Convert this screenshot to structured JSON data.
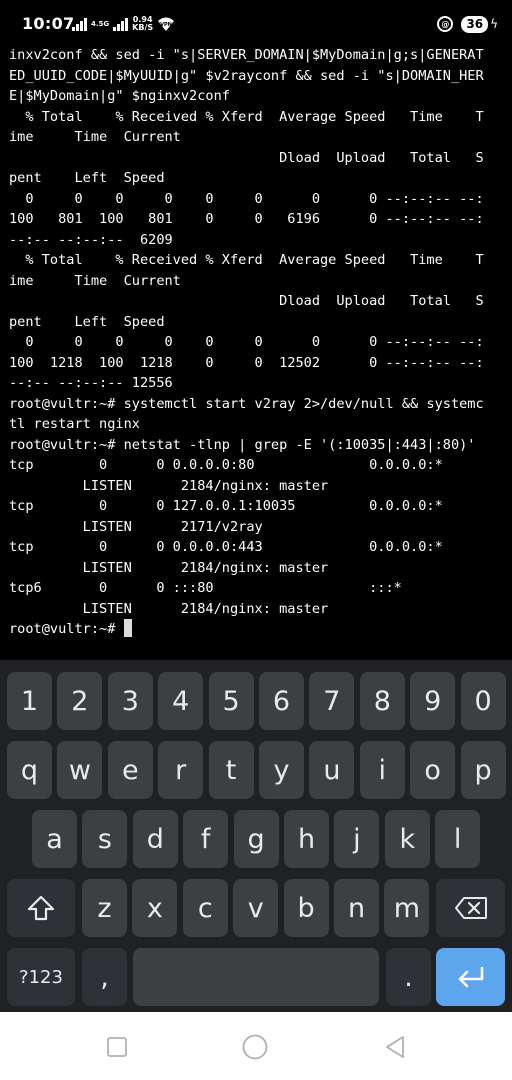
{
  "status": {
    "time": "10:07",
    "net_type": "4.5G",
    "speed_value": "0.94",
    "speed_unit": "KB/S",
    "vpn": "VPN",
    "alarm": "@",
    "battery": "36"
  },
  "terminal": {
    "lines": [
      "inxv2conf && sed -i \"s|SERVER_DOMAIN|$MyDomain|g;s|GENERAT",
      "ED_UUID_CODE|$MyUUID|g\" $v2rayconf && sed -i \"s|DOMAIN_HER",
      "E|$MyDomain|g\" $nginxv2conf",
      "  % Total    % Received % Xferd  Average Speed   Time    T",
      "ime     Time  Current",
      "                                 Dload  Upload   Total   S",
      "pent    Left  Speed",
      "  0     0    0     0    0     0      0      0 --:--:-- --:",
      "100   801  100   801    0     0   6196      0 --:--:-- --:",
      "--:-- --:--:--  6209",
      "  % Total    % Received % Xferd  Average Speed   Time    T",
      "ime     Time  Current",
      "                                 Dload  Upload   Total   S",
      "pent    Left  Speed",
      "  0     0    0     0    0     0      0      0 --:--:-- --:",
      "100  1218  100  1218    0     0  12502      0 --:--:-- --:",
      "--:-- --:--:-- 12556",
      "root@vultr:~# systemctl start v2ray 2>/dev/null && systemc",
      "tl restart nginx",
      "root@vultr:~# netstat -tlnp | grep -E '(:10035|:443|:80)'",
      "tcp        0      0 0.0.0.0:80              0.0.0.0:*",
      "         LISTEN      2184/nginx: master",
      "tcp        0      0 127.0.0.1:10035         0.0.0.0:*",
      "         LISTEN      2171/v2ray",
      "tcp        0      0 0.0.0.0:443             0.0.0.0:*",
      "         LISTEN      2184/nginx: master",
      "tcp6       0      0 :::80                   :::*",
      "         LISTEN      2184/nginx: master"
    ],
    "prompt": "root@vultr:~# "
  },
  "keyboard": {
    "row1": [
      "1",
      "2",
      "3",
      "4",
      "5",
      "6",
      "7",
      "8",
      "9",
      "0"
    ],
    "row2": [
      "q",
      "w",
      "e",
      "r",
      "t",
      "y",
      "u",
      "i",
      "o",
      "p"
    ],
    "row3": [
      "a",
      "s",
      "d",
      "f",
      "g",
      "h",
      "j",
      "k",
      "l"
    ],
    "row4": [
      "z",
      "x",
      "c",
      "v",
      "b",
      "n",
      "m"
    ],
    "symbols_label": "?123",
    "comma": ",",
    "period": "."
  },
  "icons": {
    "shift": "shift-arrow-icon",
    "backspace": "backspace-icon",
    "enter": "enter-arrow-icon",
    "recents": "square-icon",
    "home": "circle-icon",
    "back": "triangle-back-icon"
  },
  "colors": {
    "terminal_bg": "#000000",
    "keyboard_bg": "#202124",
    "key_bg": "#3c4043",
    "enter_key": "#5da6ee",
    "navbar_bg": "#ffffff"
  }
}
